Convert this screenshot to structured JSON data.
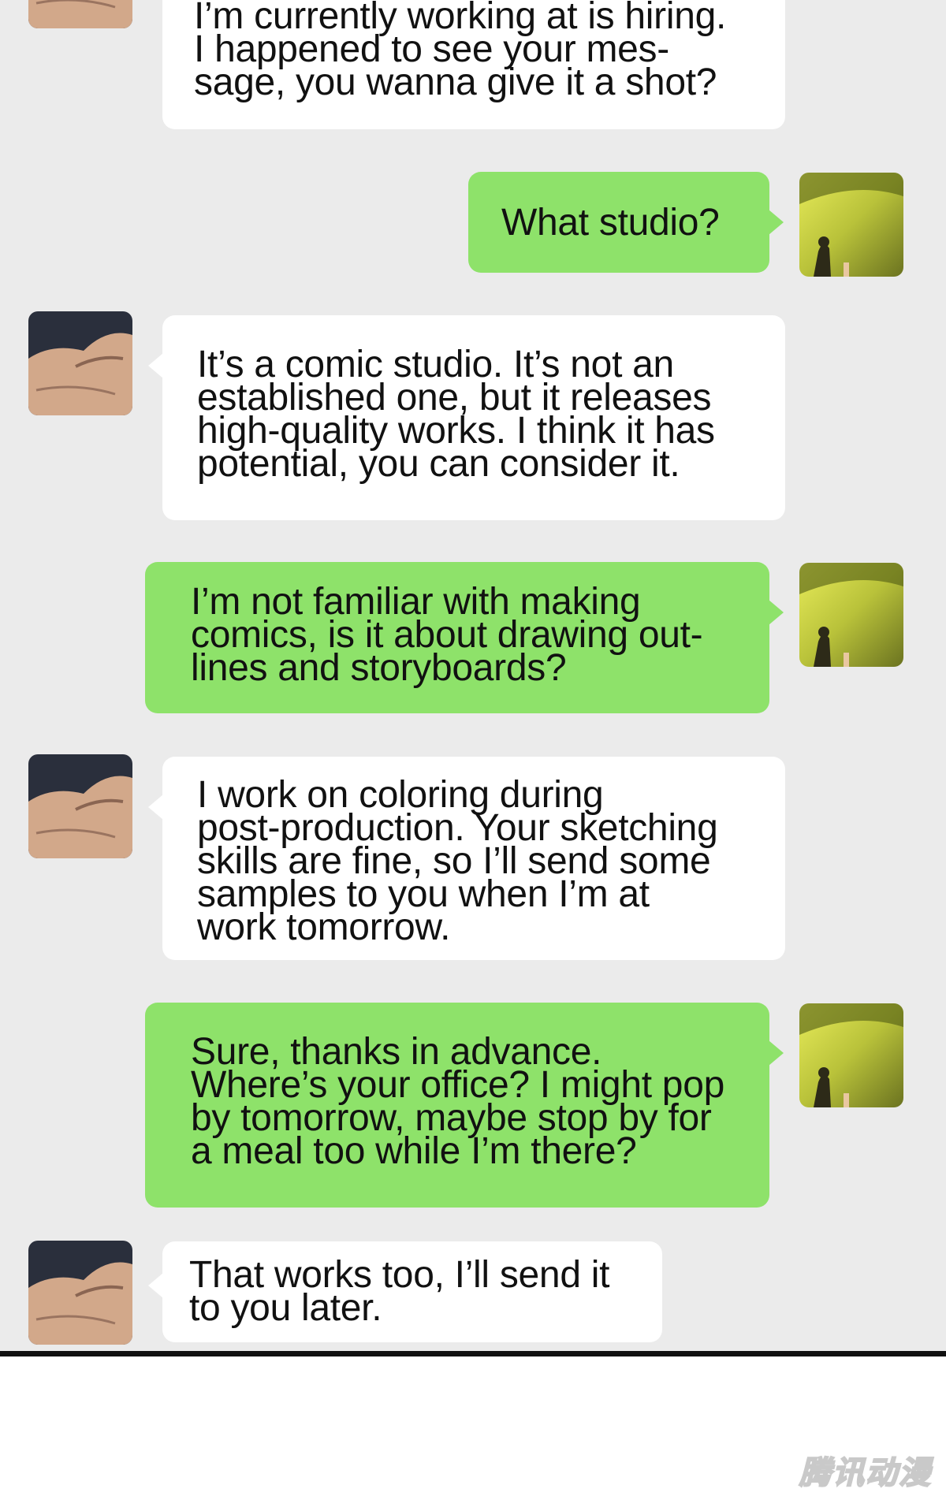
{
  "chat": {
    "messages": [
      {
        "sender": "other",
        "text": "I’m currently working at is hiring.\nI happened to see your mes-\nsage, you wanna give it a shot?"
      },
      {
        "sender": "me",
        "text": "What studio?"
      },
      {
        "sender": "other",
        "text": "It’s a comic studio. It’s not an\nestablished one, but it releases\nhigh-quality works. I think it has\npotential, you can consider it."
      },
      {
        "sender": "me",
        "text": "I’m not familiar with making\ncomics, is it about drawing out-\nlines and storyboards?"
      },
      {
        "sender": "other",
        "text": "I work on coloring during\npost-production. Your sketching\nskills are fine, so I’ll send some\nsamples to you when I’m at\nwork tomorrow."
      },
      {
        "sender": "me",
        "text": "Sure, thanks in advance.\nWhere’s your office? I might pop\nby tomorrow, maybe stop by for\na meal too while I’m there?"
      },
      {
        "sender": "other",
        "text": "That works too, I’ll send it\nto you later."
      }
    ],
    "avatars": {
      "other": "muscular-arm-avatar",
      "me": "sunset-figures-avatar"
    }
  },
  "watermark": {
    "text": "腾讯动漫"
  },
  "colors": {
    "chat_background": "#ebebeb",
    "incoming_bubble": "#ffffff",
    "outgoing_bubble": "#8ee26a",
    "text": "#111111",
    "divider": "#111111"
  }
}
